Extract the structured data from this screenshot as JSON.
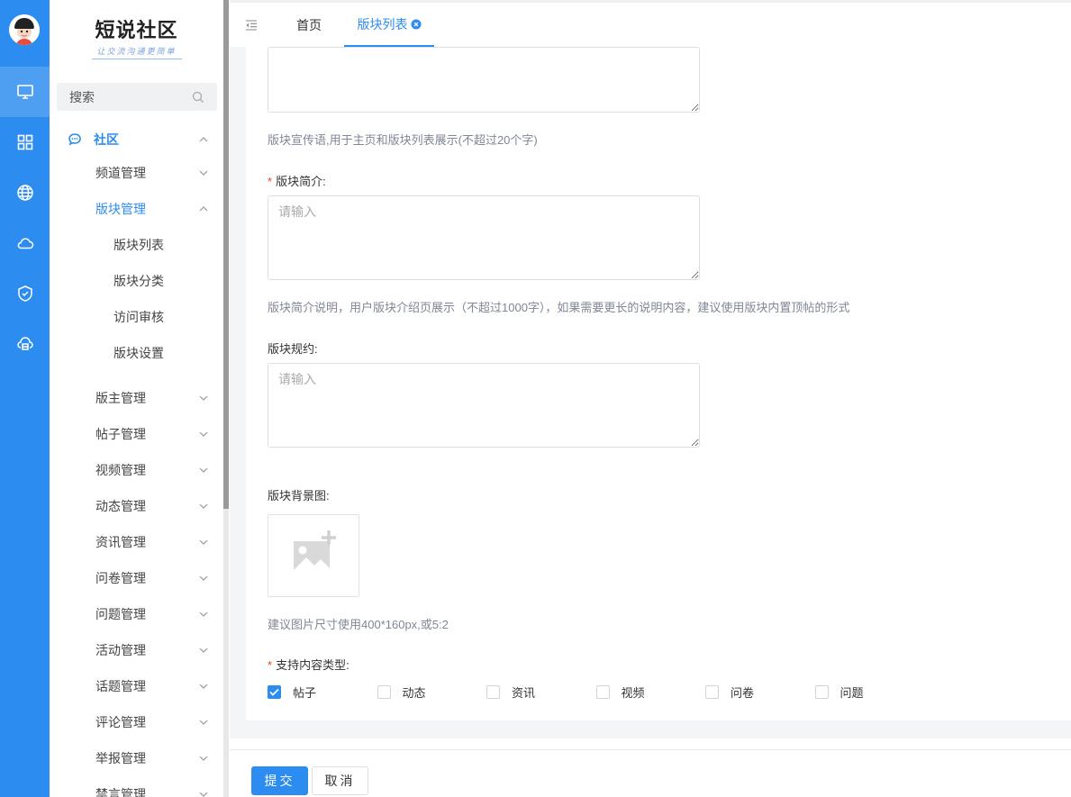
{
  "logo": {
    "title": "短说社区",
    "subtitle": "让交流沟通更简单"
  },
  "search": {
    "placeholder": "搜索"
  },
  "menu": {
    "community": "社区",
    "channel_mgmt": "频道管理",
    "board_mgmt": "版块管理",
    "board_list": "版块列表",
    "board_category": "版块分类",
    "access_review": "访问审核",
    "board_settings": "版块设置",
    "items": [
      "版主管理",
      "帖子管理",
      "视频管理",
      "动态管理",
      "资讯管理",
      "问卷管理",
      "问题管理",
      "活动管理",
      "话题管理",
      "评论管理",
      "举报管理",
      "禁言管理"
    ]
  },
  "tabs": {
    "home": "首页",
    "board_list": "版块列表"
  },
  "form": {
    "slogan_hint": "版块宣传语,用于主页和版块列表展示(不超过20个字)",
    "intro_label": "版块简介:",
    "intro_placeholder": "请输入",
    "intro_hint": "版块简介说明，用户版块介绍页展示（不超过1000字），如果需要更长的说明内容，建议使用版块内置顶帖的形式",
    "rules_label": "版块规约:",
    "rules_placeholder": "请输入",
    "bg_label": "版块背景图:",
    "bg_hint": "建议图片尺寸使用400*160px,或5:2",
    "types_label": "支持内容类型:",
    "types": [
      {
        "label": "帖子",
        "checked": true
      },
      {
        "label": "动态",
        "checked": false
      },
      {
        "label": "资讯",
        "checked": false
      },
      {
        "label": "视频",
        "checked": false
      },
      {
        "label": "问卷",
        "checked": false
      },
      {
        "label": "问题",
        "checked": false
      }
    ]
  },
  "footer": {
    "submit": "提交",
    "cancel": "取消"
  },
  "colors": {
    "primary": "#2d8cf0",
    "required": "#ed4014",
    "rail": "#2d8cf0"
  }
}
